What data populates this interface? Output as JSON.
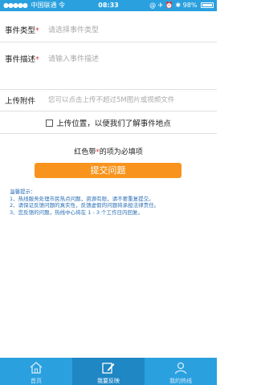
{
  "status_bar": {
    "carrier": "中国联通",
    "signal_dots": "●●●●●",
    "network": "令",
    "time": "08:33",
    "indicators": "@ ✈ ⏰ ✱",
    "battery_text": "98%",
    "battery_level": 0.98
  },
  "form": {
    "event_type": {
      "label": "事件类型",
      "required_mark": "*",
      "placeholder": "请选择事件类型"
    },
    "event_desc": {
      "label": "事件描述",
      "required_mark": "*",
      "placeholder": "请输入事件描述"
    },
    "attachment": {
      "label": "上传附件",
      "placeholder": "您可以点击上传不超过5M图片或视频文件"
    },
    "upload_location": "上传位置，以便我们了解事件地点",
    "required_note": {
      "prefix": "红色带",
      "star": "*",
      "suffix": "的项为必填项"
    },
    "submit_label": "提交问题"
  },
  "tips": {
    "title": "温馨提示：",
    "lines": [
      "1、热线服务处理市民热点问题，资源有限，请不要重复提交。",
      "2、请保证反馈问题的真实性，反馈虚假的问题将承担法律责任。",
      "3、您反馈的问题，热线中心将在 1 - 3 个工作日内回复。"
    ]
  },
  "tab_bar": {
    "tabs": [
      {
        "label": "首页",
        "icon": "home-icon",
        "active": false
      },
      {
        "label": "我要反映",
        "icon": "edit-icon",
        "active": true
      },
      {
        "label": "我的热线",
        "icon": "user-icon",
        "active": false
      }
    ]
  },
  "colors": {
    "brand_blue": "#2aa0df",
    "active_tab": "#1e87c4",
    "submit_orange": "#f8941d",
    "required_red": "#e23b3b",
    "tips_blue": "#2a6fb6"
  }
}
